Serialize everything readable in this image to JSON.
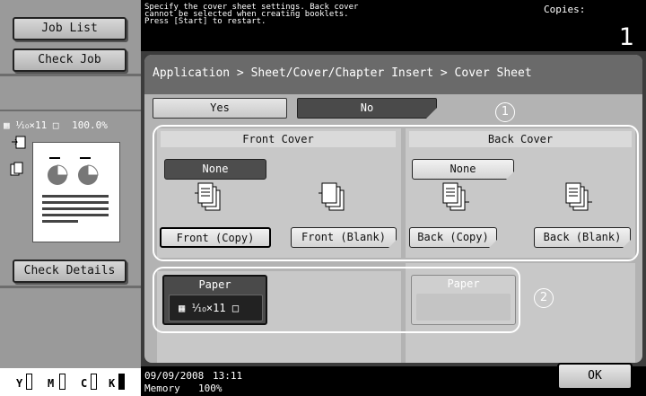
{
  "sidebar": {
    "job_list": "Job List",
    "check_job": "Check Job",
    "paper_size": "⅒×11",
    "zoom": "100.0%",
    "check_details": "Check Details",
    "toner": [
      "Y",
      "M",
      "C",
      "K"
    ]
  },
  "banner": {
    "message": "Specify the cover sheet settings. Back cover\ncannot be selected when creating booklets.\nPress [Start] to restart.",
    "copies_label": "Copies:",
    "copies_value": "1"
  },
  "main": {
    "breadcrumb": "Application > Sheet/Cover/Chapter Insert > Cover Sheet",
    "yes": "Yes",
    "no": "No",
    "callouts": [
      "1",
      "2"
    ],
    "front": {
      "title": "Front Cover",
      "none": "None",
      "copy": "Front (Copy)",
      "blank": "Front (Blank)"
    },
    "back": {
      "title": "Back Cover",
      "none": "None",
      "copy": "Back  (Copy)",
      "blank": "Back (Blank)"
    },
    "paper": {
      "label_front": "Paper",
      "value_front": "⅒×11",
      "label_back": "Paper"
    }
  },
  "status": {
    "date": "09/09/2008",
    "time": "13:11",
    "memory_label": "Memory",
    "memory_value": "100%",
    "ok": "OK"
  },
  "colors": {
    "sidebar_bg": "#9a9a9a",
    "banner_bg": "#000000",
    "panel_bg": "#b3b3b3",
    "selected_bg": "#4a4a4a"
  }
}
